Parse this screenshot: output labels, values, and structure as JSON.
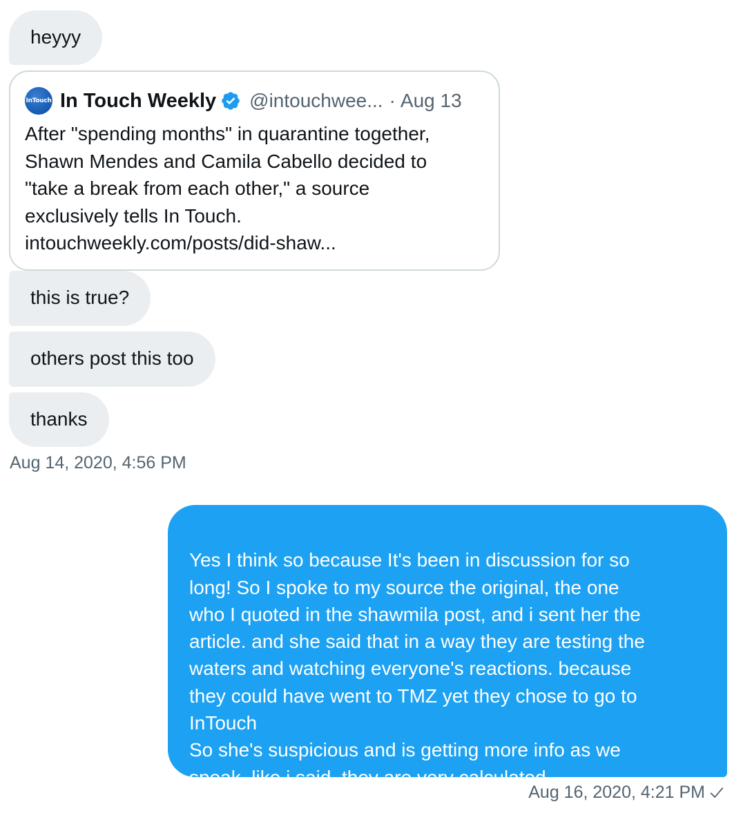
{
  "conversation": {
    "incoming": {
      "messages": [
        "heyyy",
        "this is true?",
        "others post this too",
        "thanks"
      ],
      "timestamp": "Aug 14, 2020, 4:56 PM"
    },
    "shared_tweet": {
      "avatar_text": "InTouch",
      "author_name": "In Touch Weekly",
      "verified": true,
      "handle": "@intouchwee...",
      "separator": "·",
      "date": "Aug 13",
      "text": "After \"spending months\" in quarantine together,\nShawn Mendes and Camila Cabello decided to\n\"take a break from each other,\" a source\nexclusively tells In Touch.\nintouchweekly.com/posts/did-shaw..."
    },
    "outgoing": {
      "message": "Yes I think so because It's been in discussion for so\nlong! So I spoke to my source the original, the one\nwho I quoted in the shawmila post, and i sent her the\narticle. and she said that in a way they are testing the\nwaters and watching everyone's reactions. because\nthey could have went to TMZ yet they chose to go to\nInTouch\nSo she's suspicious and is getting more info as we\nspeak. like i said, they are very calculated",
      "timestamp": "Aug 16, 2020, 4:21 PM",
      "status_icon": "check-icon"
    }
  },
  "colors": {
    "incoming_bubble": "#ebeef0",
    "outgoing_bubble": "#1da1f2",
    "verified_badge": "#1d9bf0",
    "secondary_text": "#536471",
    "card_border": "#cfd9de"
  }
}
